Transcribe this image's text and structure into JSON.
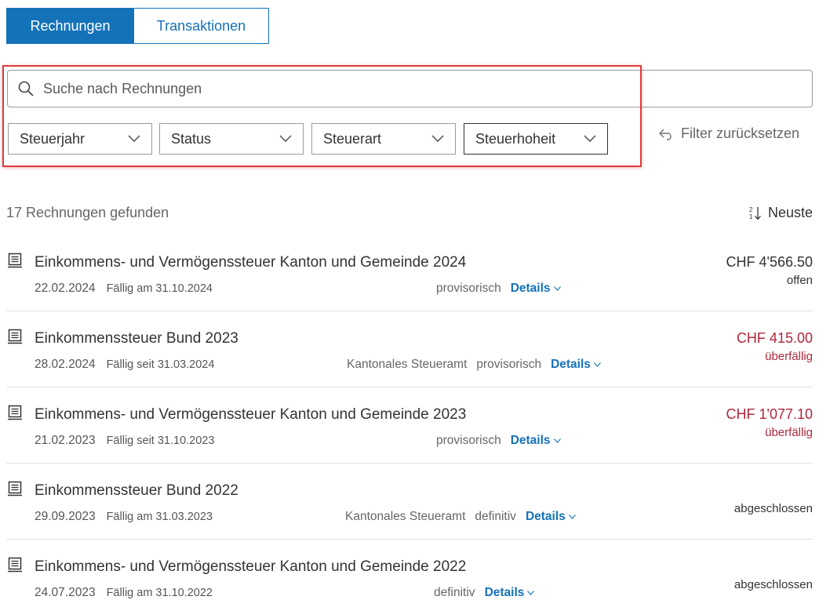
{
  "tabs": [
    {
      "label": "Rechnungen",
      "active": true
    },
    {
      "label": "Transaktionen",
      "active": false
    }
  ],
  "search": {
    "placeholder": "Suche nach Rechnungen",
    "value": ""
  },
  "filters": {
    "tax_year": "Steuerjahr",
    "status": "Status",
    "tax_type": "Steuerart",
    "tax_authority": "Steuerhoheit",
    "reset_label": "Filter zurücksetzen"
  },
  "results": {
    "count_text": "17 Rechnungen gefunden",
    "sort_label": "Neuste"
  },
  "invoices": [
    {
      "title": "Einkommens- und Vermögenssteuer Kanton und Gemeinde 2024",
      "date": "22.02.2024",
      "due": "Fällig am 31.10.2024",
      "office": "",
      "kind": "provisorisch",
      "details": "Details",
      "amount": "CHF 4'566.50",
      "status": "offen"
    },
    {
      "title": "Einkommenssteuer Bund 2023",
      "date": "28.02.2024",
      "due": "Fällig seit 31.03.2024",
      "office": "Kantonales Steueramt",
      "kind": "provisorisch",
      "details": "Details",
      "amount": "CHF 415.00",
      "status": "überfällig"
    },
    {
      "title": "Einkommens- und Vermögenssteuer Kanton und Gemeinde 2023",
      "date": "21.02.2023",
      "due": "Fällig seit 31.10.2023",
      "office": "",
      "kind": "provisorisch",
      "details": "Details",
      "amount": "CHF 1'077.10",
      "status": "überfällig"
    },
    {
      "title": "Einkommenssteuer Bund 2022",
      "date": "29.09.2023",
      "due": "Fällig am 31.03.2023",
      "office": "Kantonales Steueramt",
      "kind": "definitiv",
      "details": "Details",
      "amount": "",
      "status": "abgeschlossen"
    },
    {
      "title": "Einkommens- und Vermögenssteuer Kanton und Gemeinde 2022",
      "date": "24.07.2023",
      "due": "Fällig am 31.10.2022",
      "office": "",
      "kind": "definitiv",
      "details": "Details",
      "amount": "",
      "status": "abgeschlossen"
    }
  ],
  "colors": {
    "accent": "#1472b8",
    "overdue": "#b0263b",
    "highlight": "#e03c3c"
  }
}
